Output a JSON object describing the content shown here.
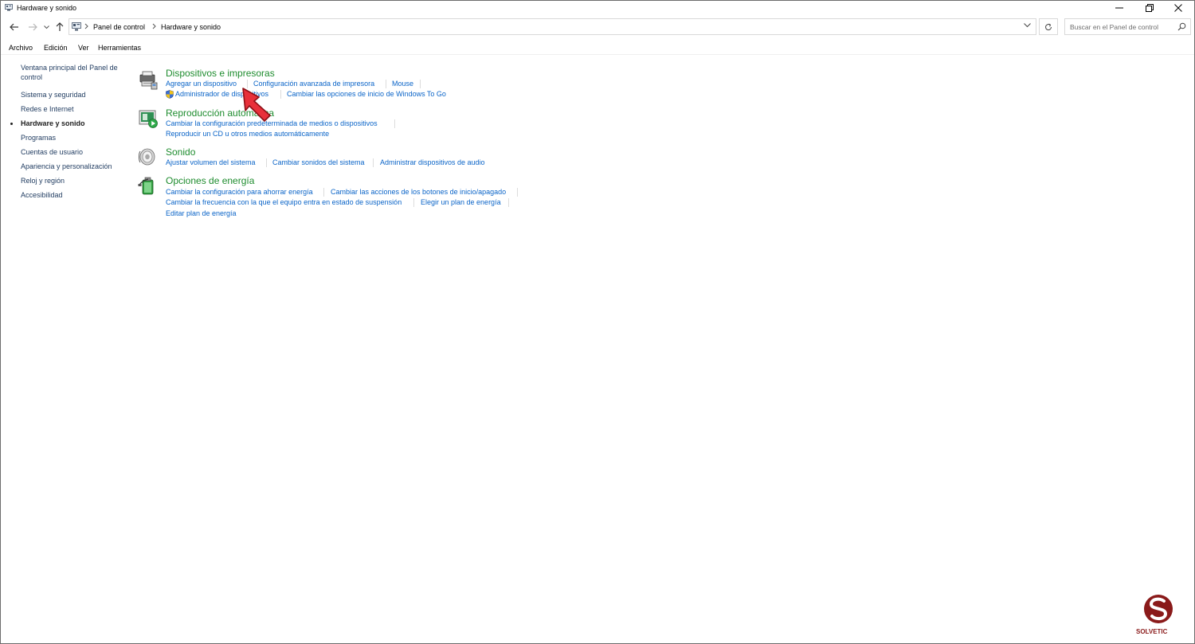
{
  "window": {
    "title": "Hardware y sonido"
  },
  "address": {
    "crumbs": [
      "Panel de control",
      "Hardware y sonido"
    ]
  },
  "search": {
    "placeholder": "Buscar en el Panel de control"
  },
  "menu": [
    "Archivo",
    "Edición",
    "Ver",
    "Herramientas"
  ],
  "sidebar": {
    "items": [
      "Ventana principal del Panel de control",
      "Sistema y seguridad",
      "Redes e Internet",
      "Hardware y sonido",
      "Programas",
      "Cuentas de usuario",
      "Apariencia y personalización",
      "Reloj y región",
      "Accesibilidad"
    ],
    "current_index": 3
  },
  "sections": [
    {
      "title": "Dispositivos e impresoras",
      "icon": "devices-printers-icon",
      "rows": [
        [
          "Agregar un dispositivo",
          "Configuración avanzada de impresora",
          "Mouse"
        ],
        [
          "Administrador de dispositivos",
          "Cambiar las opciones de inicio de Windows To Go"
        ]
      ]
    },
    {
      "title": "Reproducción automática",
      "icon": "autoplay-icon",
      "rows": [
        [
          "Cambiar la configuración predeterminada de medios o dispositivos"
        ],
        [
          "Reproducir un CD u otros medios automáticamente"
        ]
      ]
    },
    {
      "title": "Sonido",
      "icon": "sound-icon",
      "rows": [
        [
          "Ajustar volumen del sistema",
          "Cambiar sonidos del sistema",
          "Administrar dispositivos de audio"
        ]
      ]
    },
    {
      "title": "Opciones de energía",
      "icon": "power-options-icon",
      "rows": [
        [
          "Cambiar la configuración para ahorrar energía",
          "Cambiar las acciones de los botones de inicio/apagado"
        ],
        [
          "Cambiar la frecuencia con la que el equipo entra en estado de suspensión",
          "Elegir un plan de energía"
        ],
        [
          "Editar plan de energía"
        ]
      ]
    }
  ],
  "watermark": {
    "text": "SOLVETIC"
  },
  "colors": {
    "section_title": "#1e8c2e",
    "link": "#0a64c8",
    "sidebar_link": "#1e3a5f",
    "cursor": "#e8303a"
  }
}
